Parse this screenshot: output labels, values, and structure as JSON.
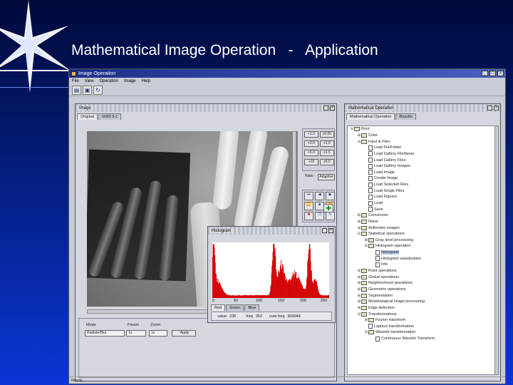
{
  "slide": {
    "title": "Mathematical Image Operation   -   Application"
  },
  "app": {
    "title": "Image Operation",
    "menu": [
      "File",
      "View",
      "Operation",
      "Image",
      "Help"
    ],
    "toolbar_icons": [
      "open-icon",
      "save-icon",
      "refresh-icon"
    ],
    "status": "Ready"
  },
  "image_frame": {
    "title": "Image",
    "tabs": [
      "Original",
      "GW2-5-1"
    ],
    "operand_buttons": [
      [
        "+1.0",
        "x0.00"
      ],
      [
        "+2.0",
        "x1.0"
      ],
      [
        "+5.0",
        "x1.5"
      ],
      [
        "+10",
        "x5.0"
      ]
    ],
    "mode_label": "Ratio",
    "mode_value": "Adaptive",
    "controls": {
      "labels": [
        "Mode",
        "Param",
        "Zoom"
      ],
      "mode_value": "Radiate/Blur",
      "param_value": "1x",
      "zoom_value": "1x",
      "apply_label": "Apply"
    }
  },
  "operations_frame": {
    "title": "Mathematical Operation",
    "tabs": [
      "Mathematical Operation",
      "Results"
    ],
    "tree": [
      {
        "label": "Root",
        "indent": 0,
        "type": "folder",
        "exp": "⊟"
      },
      {
        "label": "Color",
        "indent": 1,
        "type": "folder",
        "exp": "⊞"
      },
      {
        "label": "Input & Files",
        "indent": 1,
        "type": "folder",
        "exp": "⊟"
      },
      {
        "label": "Load FileFolder",
        "indent": 2,
        "type": "leaf"
      },
      {
        "label": "Load Gallery FileName",
        "indent": 2,
        "type": "leaf"
      },
      {
        "label": "Load Gallery Files",
        "indent": 2,
        "type": "leaf"
      },
      {
        "label": "Load Gallery Images",
        "indent": 2,
        "type": "leaf"
      },
      {
        "label": "Load Image",
        "indent": 2,
        "type": "leaf"
      },
      {
        "label": "Create Image",
        "indent": 2,
        "type": "leaf"
      },
      {
        "label": "Load Selected Files",
        "indent": 2,
        "type": "leaf"
      },
      {
        "label": "Load Single Files",
        "indent": 2,
        "type": "leaf"
      },
      {
        "label": "Load Figures",
        "indent": 2,
        "type": "leaf"
      },
      {
        "label": "Load",
        "indent": 2,
        "type": "leaf"
      },
      {
        "label": "Save",
        "indent": 2,
        "type": "leaf"
      },
      {
        "label": "Conversion",
        "indent": 1,
        "type": "folder",
        "exp": "⊞"
      },
      {
        "label": "Noise",
        "indent": 1,
        "type": "folder",
        "exp": "⊞"
      },
      {
        "label": "Arithmetic Images",
        "indent": 1,
        "type": "folder",
        "exp": "⊞"
      },
      {
        "label": "Statistical operations",
        "indent": 1,
        "type": "folder",
        "exp": "⊟"
      },
      {
        "label": "Gray level processing",
        "indent": 2,
        "type": "folder",
        "exp": "⊞"
      },
      {
        "label": "Histogram operation",
        "indent": 2,
        "type": "folder",
        "exp": "⊟"
      },
      {
        "label": "Histogram",
        "indent": 3,
        "type": "leaf",
        "selected": true
      },
      {
        "label": "Histogram equalization",
        "indent": 3,
        "type": "leaf"
      },
      {
        "label": "Info",
        "indent": 3,
        "type": "leaf"
      },
      {
        "label": "Point operations",
        "indent": 1,
        "type": "folder",
        "exp": "⊞"
      },
      {
        "label": "Global operations",
        "indent": 1,
        "type": "folder",
        "exp": "⊞"
      },
      {
        "label": "Neighborhood operations",
        "indent": 1,
        "type": "folder",
        "exp": "⊞"
      },
      {
        "label": "Geometric operations",
        "indent": 1,
        "type": "folder",
        "exp": "⊞"
      },
      {
        "label": "Segmentation",
        "indent": 1,
        "type": "folder",
        "exp": "⊞"
      },
      {
        "label": "Morphological image processing",
        "indent": 1,
        "type": "folder",
        "exp": "⊞"
      },
      {
        "label": "Edge detection",
        "indent": 1,
        "type": "folder",
        "exp": "⊞"
      },
      {
        "label": "Transformations",
        "indent": 1,
        "type": "folder",
        "exp": "⊟"
      },
      {
        "label": "Fourier transform",
        "indent": 2,
        "type": "folder",
        "exp": "⊞"
      },
      {
        "label": "Laplace transformation",
        "indent": 2,
        "type": "leaf"
      },
      {
        "label": "Wavelet transformation",
        "indent": 2,
        "type": "folder",
        "exp": "⊟"
      },
      {
        "label": "Continuous Wavelet Transform",
        "indent": 3,
        "type": "leaf"
      }
    ]
  },
  "histogram": {
    "title": "Histogram",
    "x_ticks": [
      "0",
      "50",
      "100",
      "150",
      "200",
      "250"
    ],
    "tabs": [
      "Red",
      "Green",
      "Blue"
    ],
    "value_label": "value",
    "value": "235",
    "freq_label": "freq",
    "freq": "352",
    "cumfreq_label": "cum freq",
    "cumfreq": "303044",
    "bar_color": "#d40000"
  }
}
